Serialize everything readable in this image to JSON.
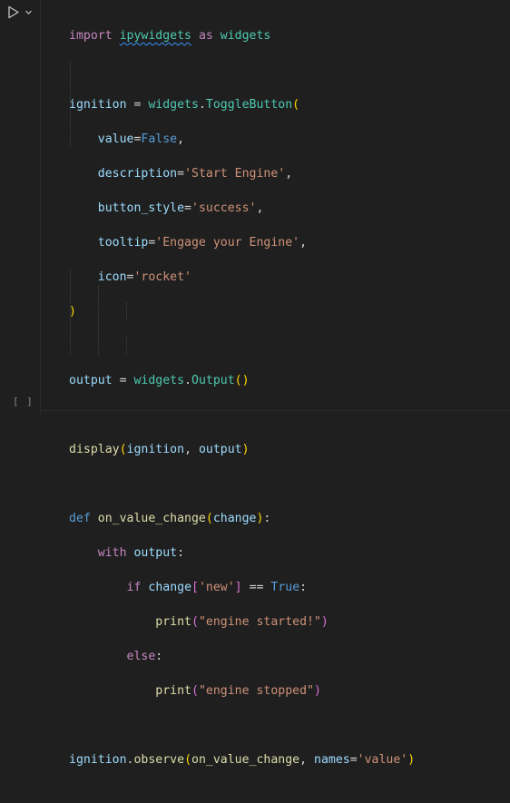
{
  "cell": {
    "execution_count": "[ ]",
    "icons": {
      "run": "play-icon",
      "expand": "chevron-down-icon"
    },
    "tokens": {
      "import": "import",
      "module": "ipywidgets",
      "as": "as",
      "alias": "widgets",
      "ignition": "ignition",
      "eq": " = ",
      "widgets": "widgets",
      "dot": ".",
      "ToggleButton": "ToggleButton",
      "lparen": "(",
      "rparen": ")",
      "value": "value",
      "equals": "=",
      "False": "False",
      "comma": ",",
      "description": "description",
      "description_val": "'Start Engine'",
      "button_style": "button_style",
      "button_style_val": "'success'",
      "tooltip": "tooltip",
      "tooltip_val": "'Engage your Engine'",
      "icon": "icon",
      "icon_val": "'rocket'",
      "output": "output",
      "Output": "Output",
      "display": "display",
      "comma_sp": ", ",
      "def": "def",
      "on_value_change": "on_value_change",
      "change": "change",
      "colon": ":",
      "with": "with",
      "if": "if",
      "lbrack": "[",
      "rbrack": "]",
      "new_key": "'new'",
      "eqeq": " == ",
      "True": "True",
      "print": "print",
      "started_msg": "\"engine started!\"",
      "else": "else",
      "stopped_msg": "\"engine stopped\"",
      "observe": "observe",
      "names": "names",
      "value_str": "'value'"
    }
  }
}
